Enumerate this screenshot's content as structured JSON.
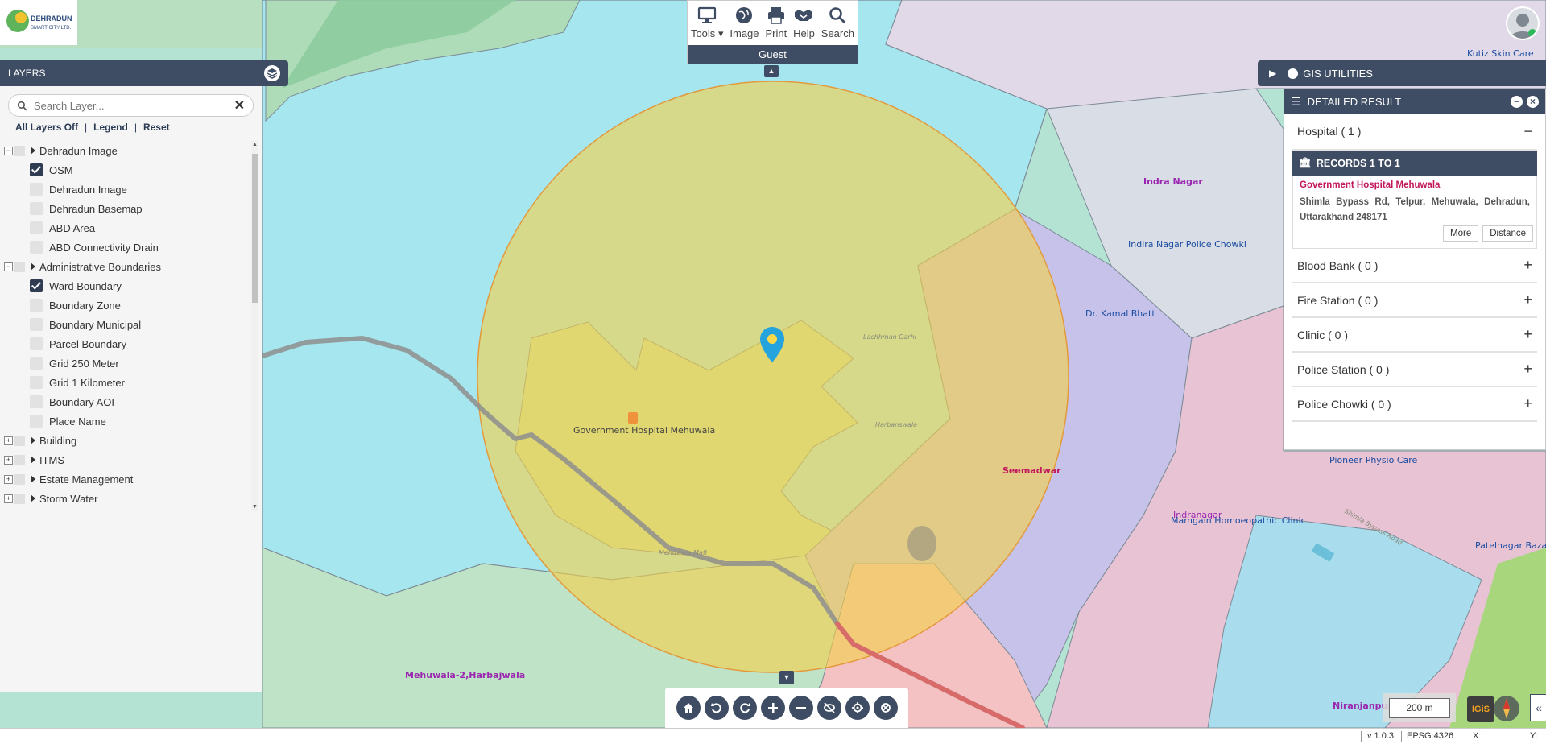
{
  "app": {
    "logo_text_1": "DEHRADUN",
    "logo_text_2": "SMART CITY LTD."
  },
  "toolbar": {
    "tools": [
      {
        "label": "Tools",
        "icon": "monitor-icon"
      },
      {
        "label": "Image",
        "icon": "globe-icon"
      },
      {
        "label": "Print",
        "icon": "printer-icon"
      },
      {
        "label": "Help",
        "icon": "handshake-icon"
      },
      {
        "label": "Search",
        "icon": "search-icon"
      }
    ],
    "user_role": "Guest"
  },
  "layers": {
    "title": "LAYERS",
    "search_placeholder": "Search Layer...",
    "links": [
      "All Layers Off",
      "Legend",
      "Reset"
    ],
    "groups": [
      {
        "label": "Dehradun Image",
        "expanded": true,
        "children": [
          {
            "label": "OSM",
            "checked": true
          },
          {
            "label": "Dehradun Image",
            "checked": false
          },
          {
            "label": "Dehradun Basemap",
            "checked": false
          },
          {
            "label": "ABD Area",
            "checked": false
          },
          {
            "label": "ABD Connectivity Drain",
            "checked": false
          }
        ]
      },
      {
        "label": "Administrative Boundaries",
        "expanded": true,
        "children": [
          {
            "label": "Ward Boundary",
            "checked": true
          },
          {
            "label": "Boundary Zone",
            "checked": false
          },
          {
            "label": "Boundary Municipal",
            "checked": false
          },
          {
            "label": "Parcel Boundary",
            "checked": false
          },
          {
            "label": "Grid 250 Meter",
            "checked": false
          },
          {
            "label": "Grid 1 Kilometer",
            "checked": false
          },
          {
            "label": "Boundary AOI",
            "checked": false
          },
          {
            "label": "Place Name",
            "checked": false
          }
        ]
      },
      {
        "label": "Building",
        "expanded": false,
        "children": []
      },
      {
        "label": "ITMS",
        "expanded": false,
        "children": []
      },
      {
        "label": "Estate Management",
        "expanded": false,
        "children": []
      },
      {
        "label": "Storm Water",
        "expanded": false,
        "children": []
      }
    ]
  },
  "gis_utilities": {
    "title": "GIS UTILITIES"
  },
  "detailed_result": {
    "title": "DETAILED RESULT",
    "hospital": {
      "label": "Hospital ( 1 )",
      "toggle": "−"
    },
    "records_label": "RECORDS 1 TO 1",
    "record": {
      "name": "Government Hospital Mehuwala",
      "address": "Shimla Bypass Rd, Telpur, Mehuwala, Dehradun, Uttarakhand 248171",
      "more": "More",
      "distance": "Distance"
    },
    "categories": [
      {
        "label": "Blood Bank ( 0 )",
        "toggle": "+"
      },
      {
        "label": "Fire Station ( 0 )",
        "toggle": "+"
      },
      {
        "label": "Clinic ( 0 )",
        "toggle": "+"
      },
      {
        "label": "Police Station ( 0 )",
        "toggle": "+"
      },
      {
        "label": "Police Chowki ( 0 )",
        "toggle": "+"
      }
    ]
  },
  "map_labels": {
    "hospital": "Government Hospital Mehuwala",
    "indra_nagar": "Indra Nagar",
    "indira_police": "Indira Nagar Police Chowki",
    "kamal_bhatt": "Dr. Kamal Bhatt",
    "kutiz": "Kutiz Skin Care",
    "seemadwar": "Seemadwar",
    "pioneer": "Pioneer Physio Care",
    "indranagar": "Indranagar",
    "mamgain": "Mamgain Homoeopathic Clinic",
    "patelnagar": "Patelnagar Bazar P",
    "mehuwala": "Mehuwala-2,Harbajwala",
    "niranjanpur": "Niranjanpur",
    "lachhman": "Lachhman Garhi",
    "harbanswala": "Harbanswala",
    "mehuwala_mafi": "Mehuwala Mafi",
    "road": "Shimla Bypass Road"
  },
  "map_controls": [
    "home-icon",
    "undo-icon",
    "redo-icon",
    "zoom-in-icon",
    "zoom-out-icon",
    "hide-icon",
    "locate-icon",
    "clear-icon"
  ],
  "scale": "200 m",
  "igis": "IGiS",
  "status": {
    "version": "v 1.0.3",
    "epsg": "EPSG:4326",
    "x": "X:",
    "y": "Y:"
  },
  "colors": {
    "panel": "#3e4d63",
    "buffer": "#f2d04a",
    "accent_pink": "#c2185b"
  }
}
